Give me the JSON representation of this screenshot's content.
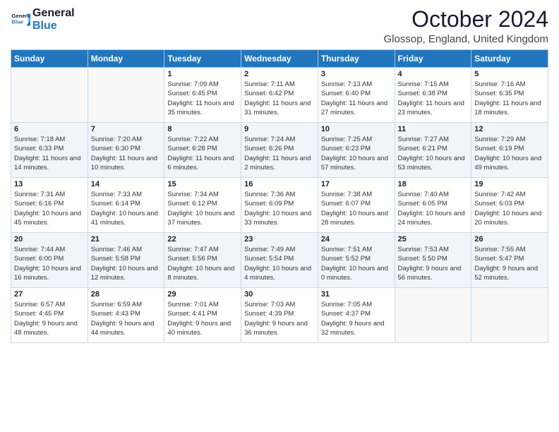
{
  "header": {
    "logo_general": "General",
    "logo_blue": "Blue",
    "month_year": "October 2024",
    "location": "Glossop, England, United Kingdom"
  },
  "days_of_week": [
    "Sunday",
    "Monday",
    "Tuesday",
    "Wednesday",
    "Thursday",
    "Friday",
    "Saturday"
  ],
  "weeks": [
    [
      {
        "day": "",
        "content": ""
      },
      {
        "day": "",
        "content": ""
      },
      {
        "day": "1",
        "content": "Sunrise: 7:09 AM\nSunset: 6:45 PM\nDaylight: 11 hours and 35 minutes."
      },
      {
        "day": "2",
        "content": "Sunrise: 7:11 AM\nSunset: 6:42 PM\nDaylight: 11 hours and 31 minutes."
      },
      {
        "day": "3",
        "content": "Sunrise: 7:13 AM\nSunset: 6:40 PM\nDaylight: 11 hours and 27 minutes."
      },
      {
        "day": "4",
        "content": "Sunrise: 7:15 AM\nSunset: 6:38 PM\nDaylight: 11 hours and 23 minutes."
      },
      {
        "day": "5",
        "content": "Sunrise: 7:16 AM\nSunset: 6:35 PM\nDaylight: 11 hours and 18 minutes."
      }
    ],
    [
      {
        "day": "6",
        "content": "Sunrise: 7:18 AM\nSunset: 6:33 PM\nDaylight: 11 hours and 14 minutes."
      },
      {
        "day": "7",
        "content": "Sunrise: 7:20 AM\nSunset: 6:30 PM\nDaylight: 11 hours and 10 minutes."
      },
      {
        "day": "8",
        "content": "Sunrise: 7:22 AM\nSunset: 6:28 PM\nDaylight: 11 hours and 6 minutes."
      },
      {
        "day": "9",
        "content": "Sunrise: 7:24 AM\nSunset: 6:26 PM\nDaylight: 11 hours and 2 minutes."
      },
      {
        "day": "10",
        "content": "Sunrise: 7:25 AM\nSunset: 6:23 PM\nDaylight: 10 hours and 57 minutes."
      },
      {
        "day": "11",
        "content": "Sunrise: 7:27 AM\nSunset: 6:21 PM\nDaylight: 10 hours and 53 minutes."
      },
      {
        "day": "12",
        "content": "Sunrise: 7:29 AM\nSunset: 6:19 PM\nDaylight: 10 hours and 49 minutes."
      }
    ],
    [
      {
        "day": "13",
        "content": "Sunrise: 7:31 AM\nSunset: 6:16 PM\nDaylight: 10 hours and 45 minutes."
      },
      {
        "day": "14",
        "content": "Sunrise: 7:33 AM\nSunset: 6:14 PM\nDaylight: 10 hours and 41 minutes."
      },
      {
        "day": "15",
        "content": "Sunrise: 7:34 AM\nSunset: 6:12 PM\nDaylight: 10 hours and 37 minutes."
      },
      {
        "day": "16",
        "content": "Sunrise: 7:36 AM\nSunset: 6:09 PM\nDaylight: 10 hours and 33 minutes."
      },
      {
        "day": "17",
        "content": "Sunrise: 7:38 AM\nSunset: 6:07 PM\nDaylight: 10 hours and 28 minutes."
      },
      {
        "day": "18",
        "content": "Sunrise: 7:40 AM\nSunset: 6:05 PM\nDaylight: 10 hours and 24 minutes."
      },
      {
        "day": "19",
        "content": "Sunrise: 7:42 AM\nSunset: 6:03 PM\nDaylight: 10 hours and 20 minutes."
      }
    ],
    [
      {
        "day": "20",
        "content": "Sunrise: 7:44 AM\nSunset: 6:00 PM\nDaylight: 10 hours and 16 minutes."
      },
      {
        "day": "21",
        "content": "Sunrise: 7:46 AM\nSunset: 5:58 PM\nDaylight: 10 hours and 12 minutes."
      },
      {
        "day": "22",
        "content": "Sunrise: 7:47 AM\nSunset: 5:56 PM\nDaylight: 10 hours and 8 minutes."
      },
      {
        "day": "23",
        "content": "Sunrise: 7:49 AM\nSunset: 5:54 PM\nDaylight: 10 hours and 4 minutes."
      },
      {
        "day": "24",
        "content": "Sunrise: 7:51 AM\nSunset: 5:52 PM\nDaylight: 10 hours and 0 minutes."
      },
      {
        "day": "25",
        "content": "Sunrise: 7:53 AM\nSunset: 5:50 PM\nDaylight: 9 hours and 56 minutes."
      },
      {
        "day": "26",
        "content": "Sunrise: 7:55 AM\nSunset: 5:47 PM\nDaylight: 9 hours and 52 minutes."
      }
    ],
    [
      {
        "day": "27",
        "content": "Sunrise: 6:57 AM\nSunset: 4:45 PM\nDaylight: 9 hours and 48 minutes."
      },
      {
        "day": "28",
        "content": "Sunrise: 6:59 AM\nSunset: 4:43 PM\nDaylight: 9 hours and 44 minutes."
      },
      {
        "day": "29",
        "content": "Sunrise: 7:01 AM\nSunset: 4:41 PM\nDaylight: 9 hours and 40 minutes."
      },
      {
        "day": "30",
        "content": "Sunrise: 7:03 AM\nSunset: 4:39 PM\nDaylight: 9 hours and 36 minutes."
      },
      {
        "day": "31",
        "content": "Sunrise: 7:05 AM\nSunset: 4:37 PM\nDaylight: 9 hours and 32 minutes."
      },
      {
        "day": "",
        "content": ""
      },
      {
        "day": "",
        "content": ""
      }
    ]
  ]
}
